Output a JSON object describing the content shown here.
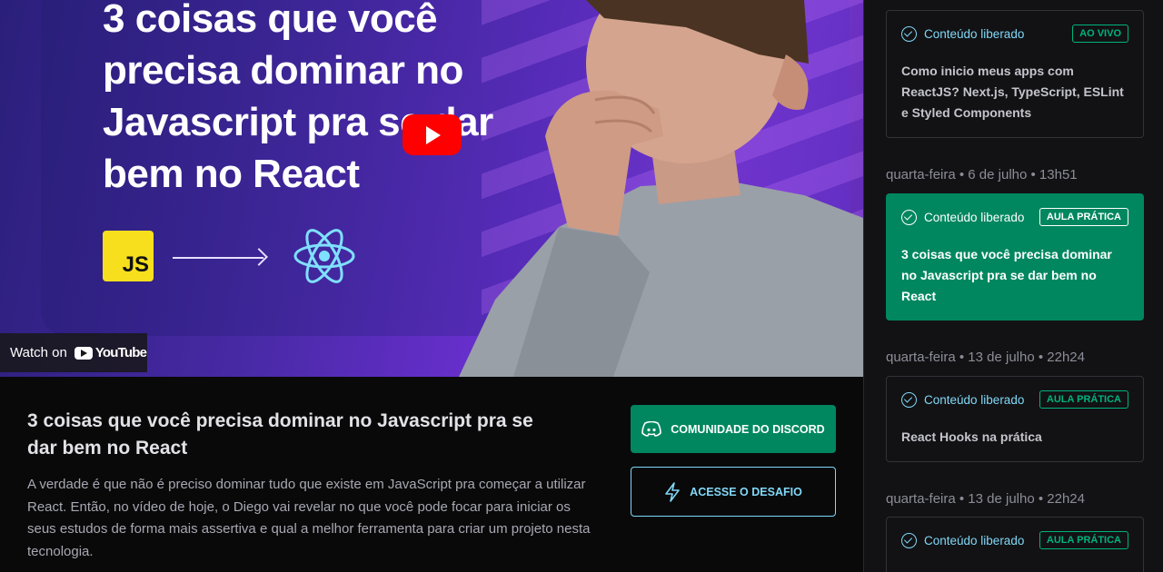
{
  "video": {
    "thumbnail_title": "3 coisas que você precisa dominar no Javascript pra se dar bem no React",
    "js_badge": "JS",
    "watch_on": "Watch on",
    "youtube_label": "YouTube"
  },
  "lesson": {
    "title": "3 coisas que você precisa dominar no Javascript pra se dar bem no React",
    "description": "A verdade é que não é preciso dominar tudo que existe em JavaScript pra começar a utilizar React. Então, no vídeo de hoje, o Diego vai revelar no que você pode focar para iniciar os seus estudos de forma mais assertiva e qual a melhor ferramenta para criar um projeto nesta tecnologia."
  },
  "actions": {
    "discord_label": "COMUNIDADE DO DISCORD",
    "challenge_label": "ACESSE O DESAFIO"
  },
  "sidebar": {
    "items": [
      {
        "date": "",
        "status": "Conteúdo liberado",
        "tag": "AO VIVO",
        "title": "Como inicio meus apps com ReactJS? Next.js, TypeScript, ESLint e Styled Components",
        "active": false
      },
      {
        "date": "quarta-feira • 6 de julho • 13h51",
        "status": "Conteúdo liberado",
        "tag": "AULA PRÁTICA",
        "title": "3 coisas que você precisa dominar no Javascript pra se dar bem no React",
        "active": true
      },
      {
        "date": "quarta-feira • 13 de julho • 22h24",
        "status": "Conteúdo liberado",
        "tag": "AULA PRÁTICA",
        "title": "React Hooks na prática",
        "active": false
      },
      {
        "date": "quarta-feira • 13 de julho • 22h24",
        "status": "Conteúdo liberado",
        "tag": "AULA PRÁTICA",
        "title": "",
        "active": false
      }
    ]
  },
  "colors": {
    "accent_green": "#00875f",
    "accent_blue": "#81d8f7",
    "background": "#09090a",
    "sidebar_bg": "#121214"
  }
}
